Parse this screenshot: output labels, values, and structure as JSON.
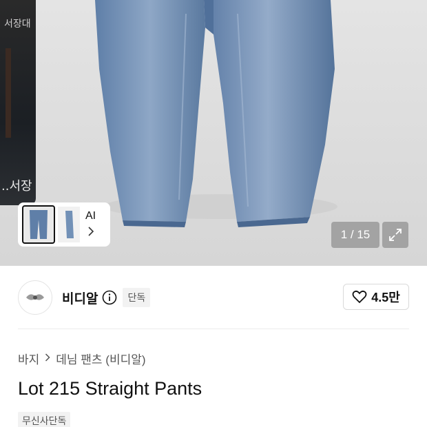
{
  "gallery": {
    "side_sign_top": "서장대",
    "side_sign_bottom": "..서장",
    "ai_label": "AI",
    "pager_current": 1,
    "pager_total": 15,
    "pager_text": "1 / 15"
  },
  "brand": {
    "name": "비디알",
    "tag": "단독",
    "likes": "4.5만"
  },
  "breadcrumb": {
    "items": [
      "바지",
      "데님 팬츠 (비디알)"
    ]
  },
  "product": {
    "title": "Lot 215 Straight Pants",
    "badge": "무신사단독"
  },
  "icons": {
    "info": "info-icon",
    "heart": "heart-icon",
    "expand": "expand-icon",
    "chevron": "chevron-right-icon"
  },
  "colors": {
    "denim": "#6f8db3",
    "denim_dark": "#4a6890",
    "hero_bg": "#dcdcdc"
  }
}
